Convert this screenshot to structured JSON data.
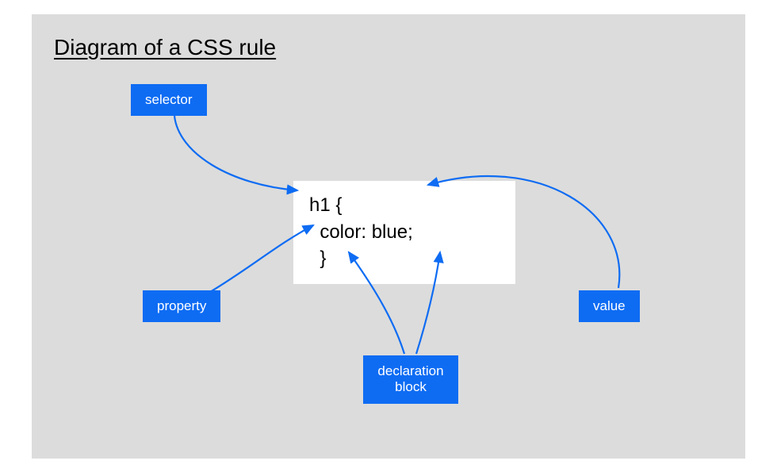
{
  "title": "Diagram of a CSS rule",
  "code": {
    "line1": "h1 {",
    "line2": "  color: blue;",
    "line3": "  }"
  },
  "labels": {
    "selector": "selector",
    "property": "property",
    "value": "value",
    "declaration_block": "declaration\nblock"
  },
  "colors": {
    "accent": "#0e6cf3",
    "panel": "#dcdcdc"
  }
}
